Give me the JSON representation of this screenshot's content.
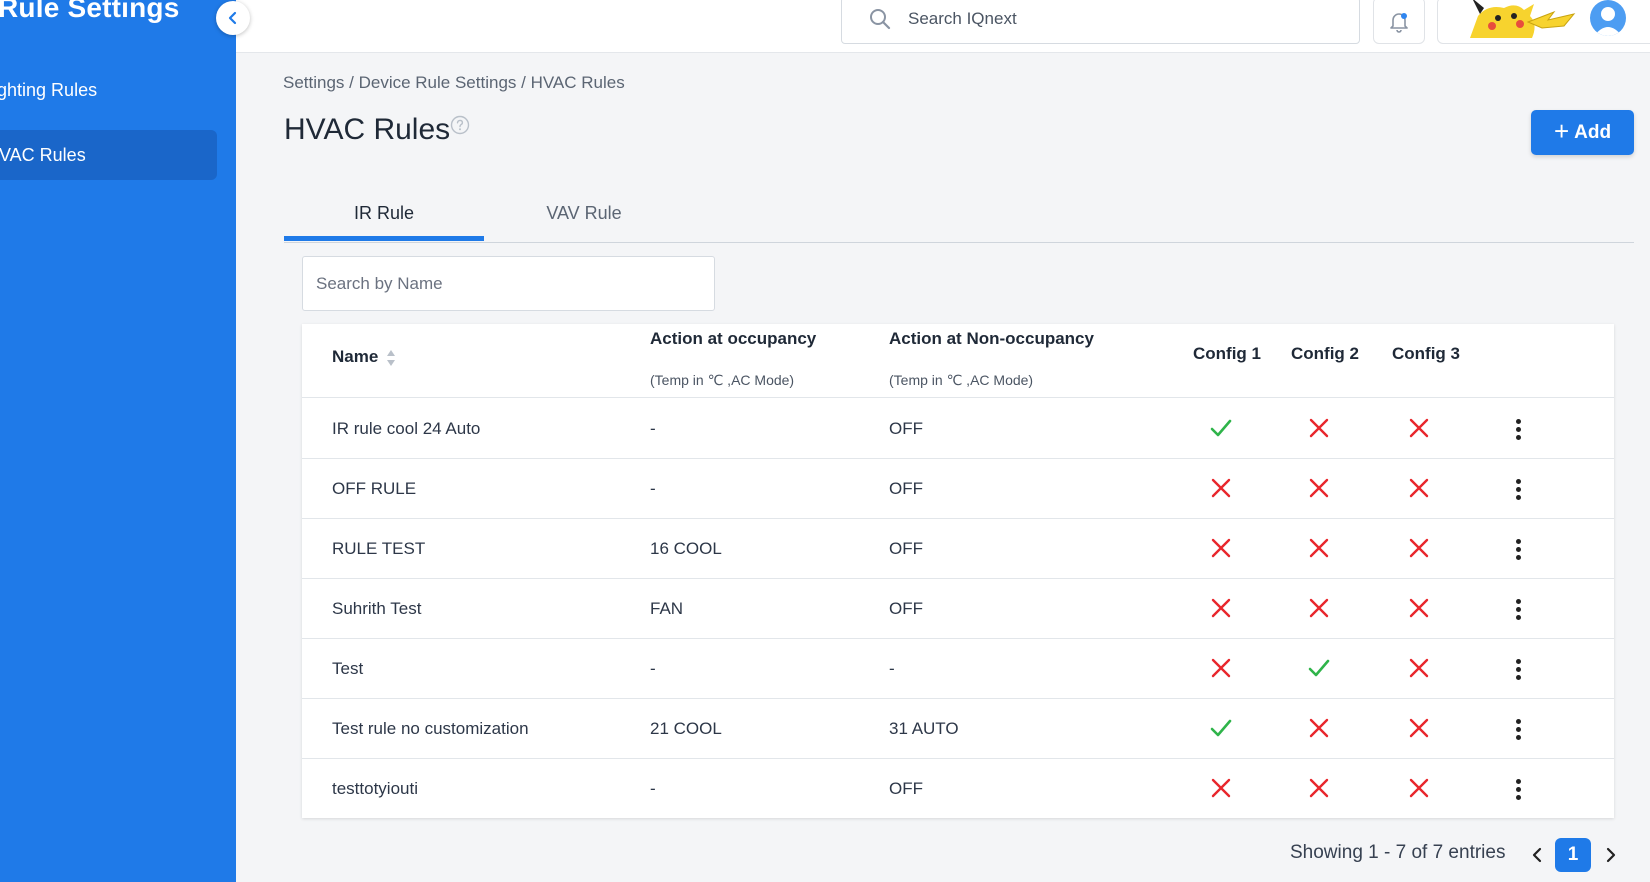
{
  "sidebar": {
    "title": "Rule Settings",
    "items": [
      {
        "label": "Lighting Rules",
        "active": false
      },
      {
        "label": "HVAC Rules",
        "active": true
      }
    ]
  },
  "topbar": {
    "search_placeholder": "Search IQnext"
  },
  "breadcrumb": "Settings / Device Rule Settings / HVAC Rules",
  "page_title": "HVAC Rules",
  "add_button": {
    "icon": "plus-icon",
    "label": "Add"
  },
  "tabs": [
    {
      "label": "IR Rule",
      "active": true
    },
    {
      "label": "VAV Rule",
      "active": false
    }
  ],
  "name_search_placeholder": "Search by Name",
  "table": {
    "headers": {
      "name": "Name",
      "occupancy": "Action at occupancy",
      "occupancy_sub": "(Temp in ℃ ,AC Mode)",
      "non_occupancy": "Action at Non-occupancy",
      "non_occupancy_sub": "(Temp in ℃ ,AC Mode)",
      "config1": "Config 1",
      "config2": "Config 2",
      "config3": "Config 3"
    },
    "rows": [
      {
        "name": "IR rule cool 24 Auto",
        "occupancy": "-",
        "non_occupancy": "OFF",
        "config": [
          true,
          false,
          false
        ]
      },
      {
        "name": "OFF RULE",
        "occupancy": "-",
        "non_occupancy": "OFF",
        "config": [
          false,
          false,
          false
        ]
      },
      {
        "name": "RULE TEST",
        "occupancy": "16 COOL",
        "non_occupancy": "OFF",
        "config": [
          false,
          false,
          false
        ]
      },
      {
        "name": "Suhrith Test",
        "occupancy": "FAN",
        "non_occupancy": "OFF",
        "config": [
          false,
          false,
          false
        ]
      },
      {
        "name": "Test",
        "occupancy": "-",
        "non_occupancy": "-",
        "config": [
          false,
          true,
          false
        ]
      },
      {
        "name": "Test rule no customization",
        "occupancy": "21 COOL",
        "non_occupancy": "31 AUTO",
        "config": [
          true,
          false,
          false
        ]
      },
      {
        "name": "testtotyiouti",
        "occupancy": "-",
        "non_occupancy": "OFF",
        "config": [
          false,
          false,
          false
        ]
      }
    ]
  },
  "pagination": {
    "summary": "Showing 1 - 7 of 7 entries",
    "current_page": "1"
  },
  "colors": {
    "primary": "#1f7ae8",
    "check": "#2fb44a",
    "cross": "#e8262c"
  }
}
